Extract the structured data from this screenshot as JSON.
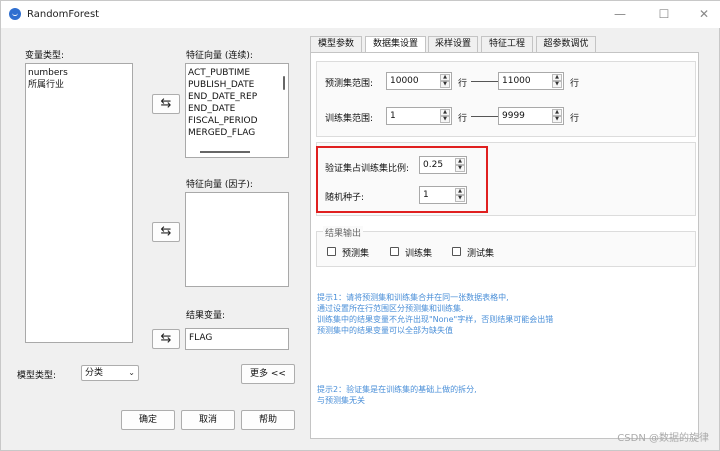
{
  "window": {
    "title": "RandomForest",
    "minimize": "—",
    "maximize": "☐",
    "close": "✕"
  },
  "left": {
    "var_type_label": "变量类型:",
    "var_types": [
      "numbers",
      "所属行业"
    ],
    "feature_cont_label": "特征向量 (连续):",
    "feature_cont": [
      "ACT_PUBTIME",
      "PUBLISH_DATE",
      "END_DATE_REP",
      "END_DATE",
      "FISCAL_PERIOD",
      "MERGED_FLAG"
    ],
    "feature_factor_label": "特征向量 (因子):",
    "feature_factor": [],
    "result_var_label": "结果变量:",
    "result_var_value": "FLAG",
    "move_glyph": "⇆",
    "model_type_label": "模型类型:",
    "model_type_value": "分类",
    "more_button": "更多 <<",
    "ok_button": "确定",
    "cancel_button": "取消",
    "help_button": "帮助"
  },
  "tabs": [
    "模型参数",
    "数据集设置",
    "采样设置",
    "特征工程",
    "超参数调优"
  ],
  "active_tab": 1,
  "dataset": {
    "predict_range_label": "预测集范围:",
    "predict_from": "10000",
    "predict_to": "11000",
    "train_range_label": "训练集范围:",
    "train_from": "1",
    "train_to": "9999",
    "row_label": "行",
    "val_ratio_label": "验证集占训练集比例:",
    "val_ratio_value": "0.25",
    "seed_label": "随机种子:",
    "seed_value": "1",
    "output_group_label": "结果输出",
    "outputs": [
      "预测集",
      "训练集",
      "测试集"
    ],
    "hint1": [
      "提示1：请将预测集和训练集合并在同一张数据表格中,",
      "通过设置所在行范围区分预测集和训练集.",
      "训练集中的结果变量不允许出现\"None\"字样，否则结果可能会出错",
      "预测集中的结果变量可以全部为缺失值"
    ],
    "hint2": [
      "提示2：验证集是在训练集的基础上做的拆分,",
      "与预测集无关"
    ]
  },
  "watermark": "CSDN @数据的旋律",
  "colors": {
    "highlight": "#e02020",
    "hint_text": "#4a8fd8",
    "app_icon": "#2f6fd0"
  }
}
